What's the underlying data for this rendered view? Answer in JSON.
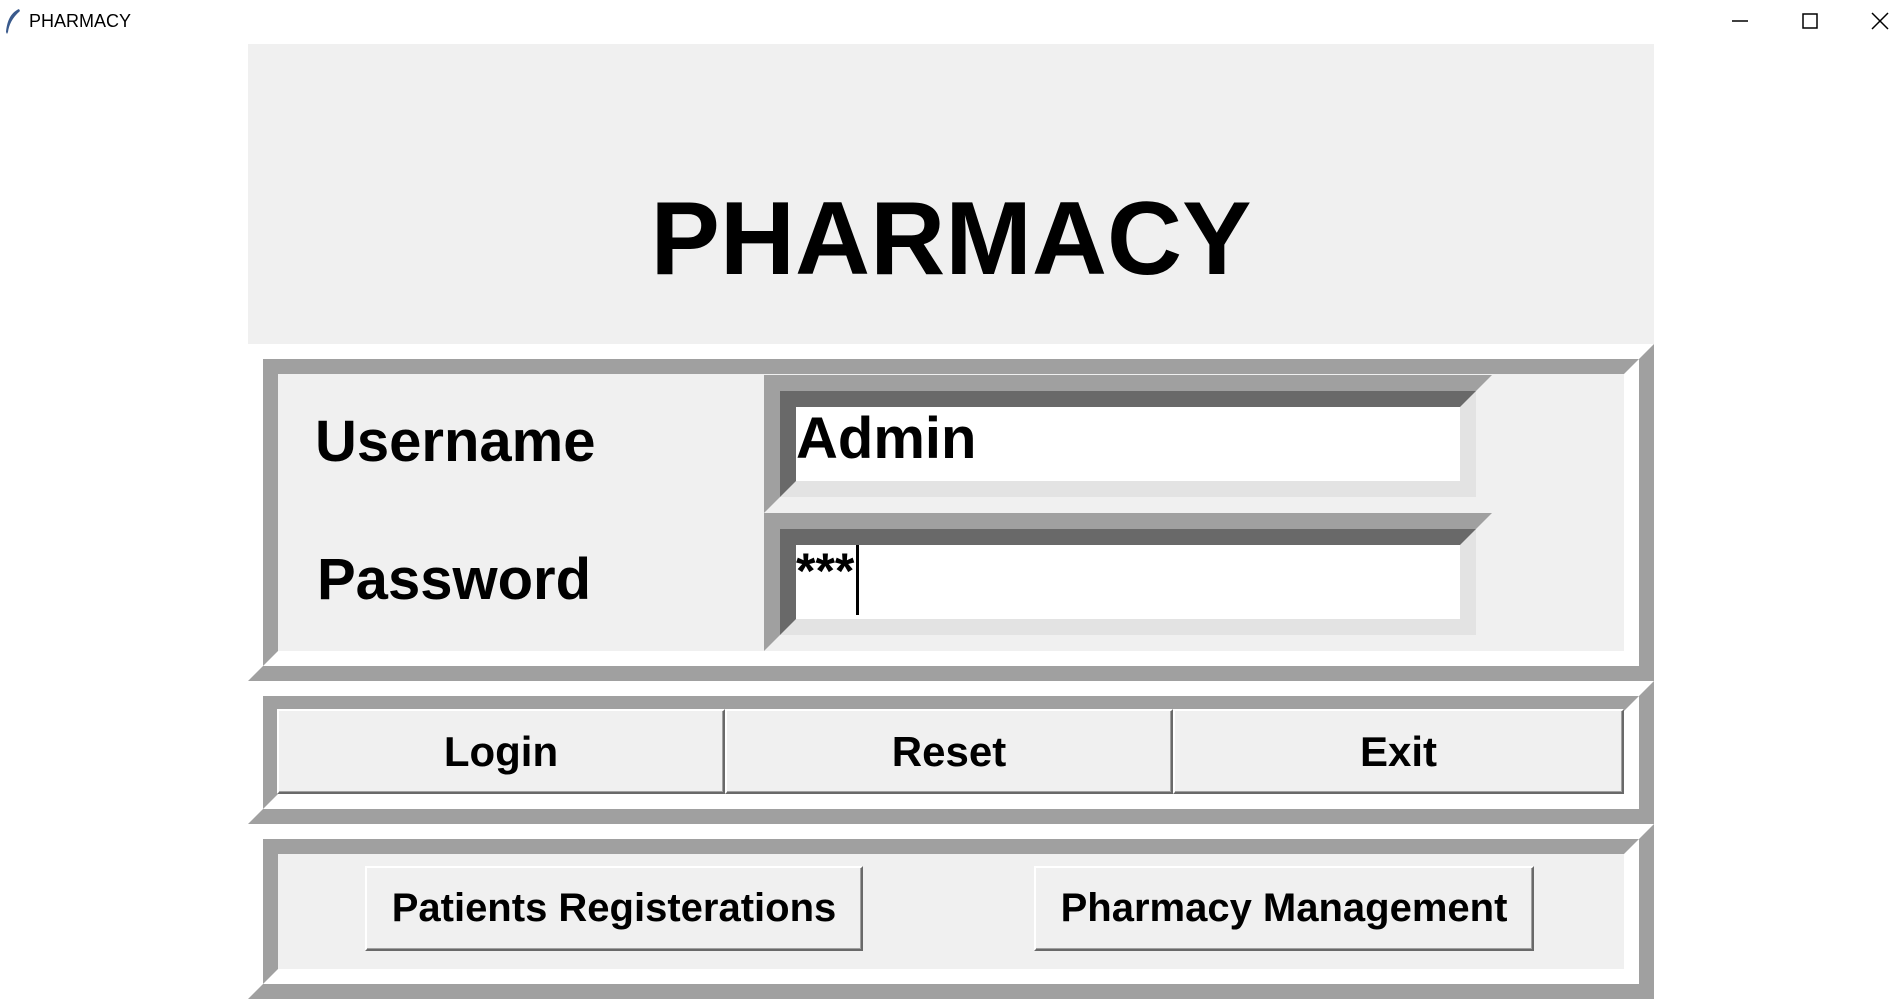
{
  "window": {
    "title": "PHARMACY",
    "app_icon": "feather-icon",
    "controls": [
      "minimize-icon",
      "maximize-icon",
      "close-icon"
    ]
  },
  "header": {
    "title": "PHARMACY"
  },
  "login": {
    "username_label": "Username",
    "password_label": "Password",
    "username_value": "Admin",
    "password_value": "***"
  },
  "actions": {
    "login_label": "Login",
    "reset_label": "Reset",
    "exit_label": "Exit"
  },
  "nav": {
    "patients_label": "Patients Registerations",
    "pharmacy_label": "Pharmacy Management"
  },
  "colors": {
    "background": "#f0f0f0",
    "bevel_dark": "#a0a0a0",
    "bevel_shadow": "#696969",
    "entry_bg": "#ffffff"
  }
}
